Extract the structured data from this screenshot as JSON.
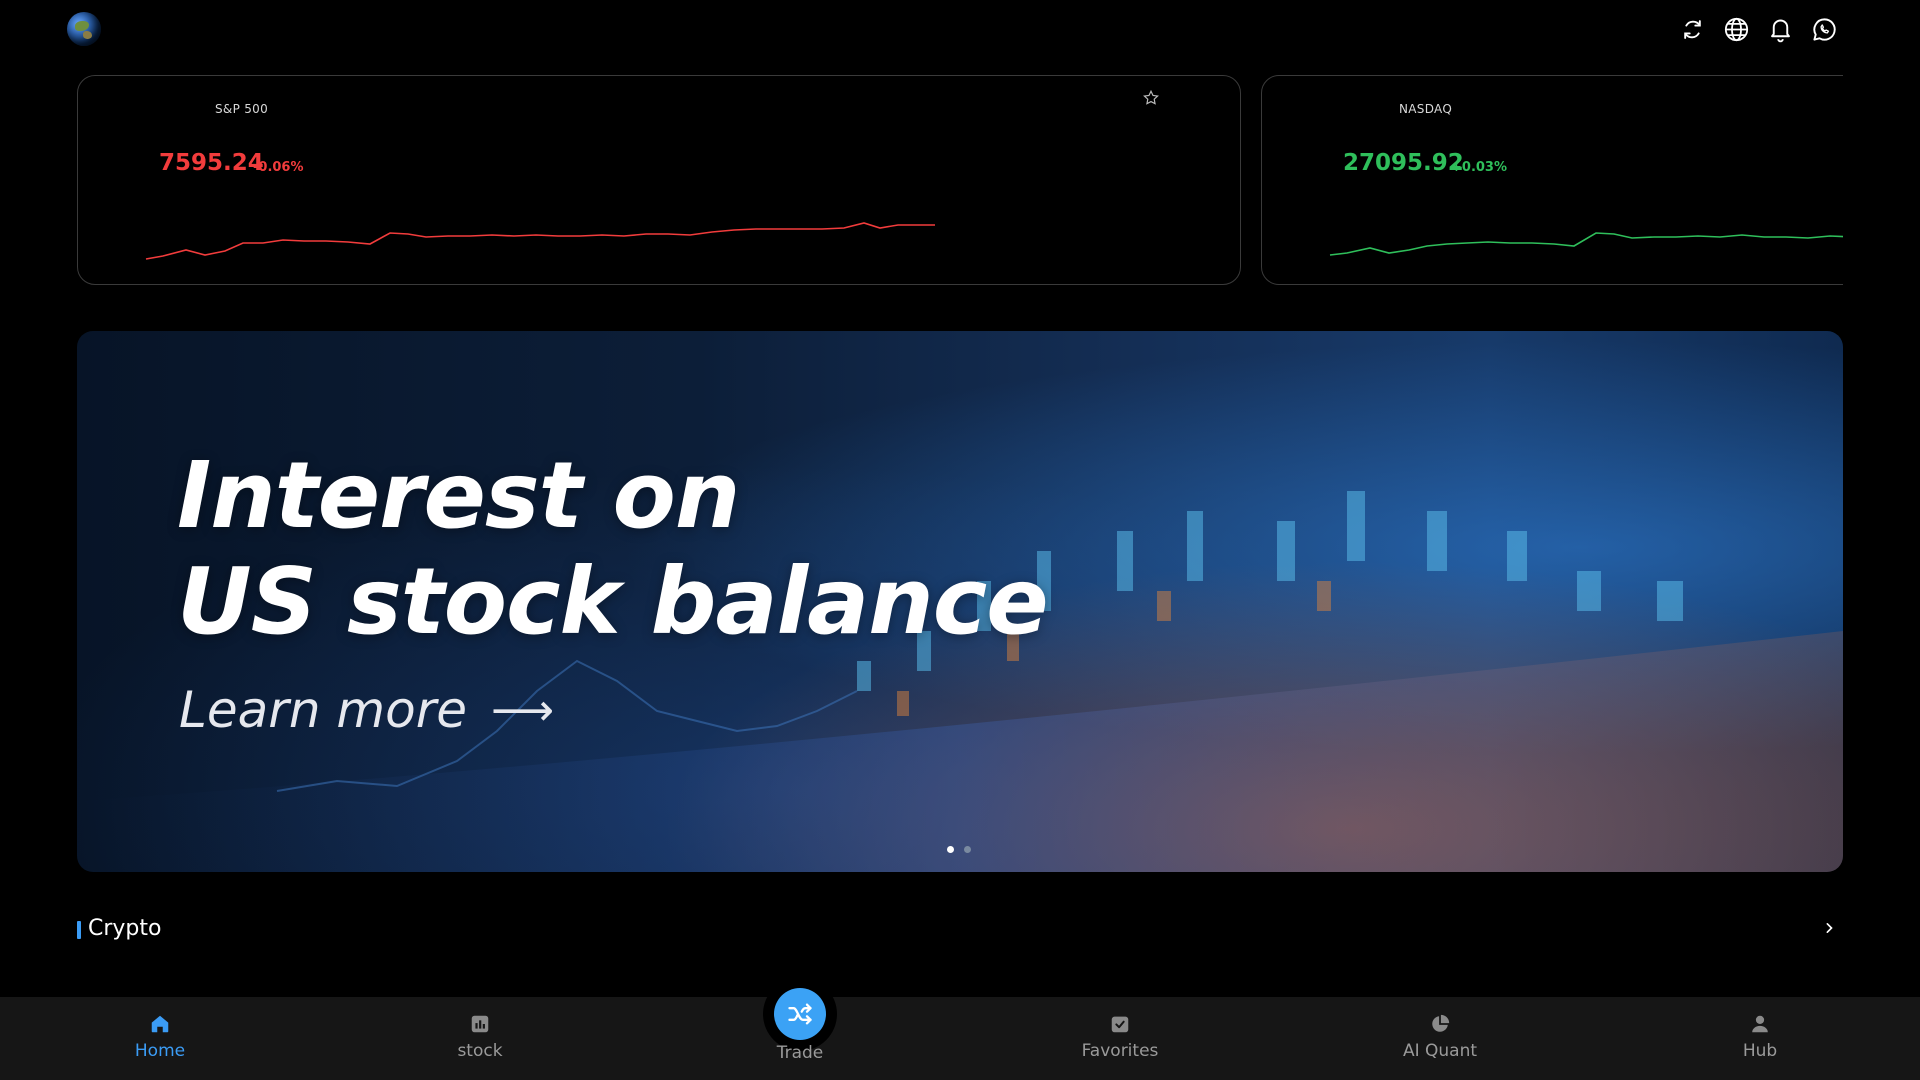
{
  "header": {
    "logo": "globe-logo",
    "icons": [
      "refresh-icon",
      "globe-icon",
      "bell-icon",
      "chat-icon"
    ]
  },
  "tickers": [
    {
      "name": "S&P 500",
      "price": "7595.24",
      "change": "-0.06%",
      "color": "#f23c3c",
      "favorite_icon": "star-outline-icon"
    },
    {
      "name": "NASDAQ",
      "price": "27095.92",
      "change": "+0.03%",
      "color": "#2fbf5b"
    }
  ],
  "banner": {
    "title_line1": "Interest on",
    "title_line2": "US stock balance",
    "cta": "Learn more",
    "cta_arrow": "⟶",
    "slides": 2,
    "active_slide": 0
  },
  "section": {
    "title": "Crypto",
    "more_icon": "chevron-right-icon"
  },
  "tabbar": {
    "tabs": [
      {
        "label": "Home",
        "icon": "home-icon",
        "active": true
      },
      {
        "label": "stock",
        "icon": "chart-icon",
        "active": false
      },
      {
        "label": "Trade",
        "icon": "shuffle-icon",
        "active": false
      },
      {
        "label": "Favorites",
        "icon": "check-folder-icon",
        "active": false
      },
      {
        "label": "AI Quant",
        "icon": "pie-chart-icon",
        "active": false
      },
      {
        "label": "Hub",
        "icon": "user-icon",
        "active": false
      }
    ],
    "accent": "#3b9cf5"
  }
}
